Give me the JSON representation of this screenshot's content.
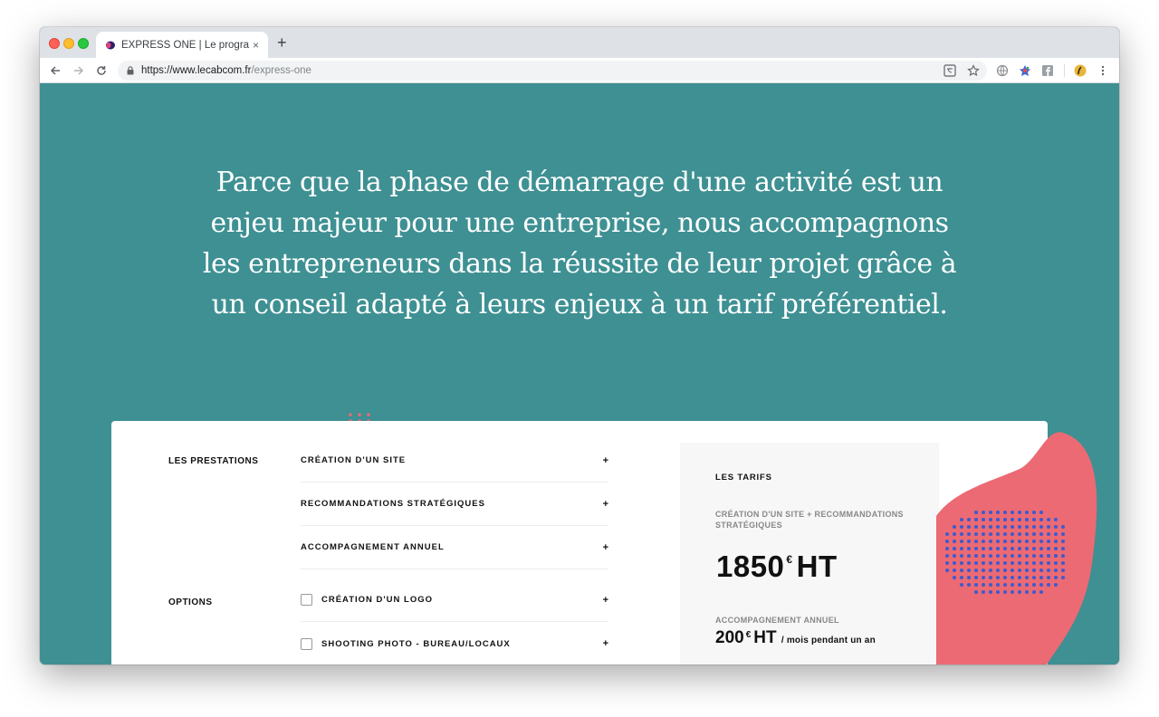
{
  "browser": {
    "tab_title": "EXPRESS ONE | Le programme",
    "tab_close": "×",
    "new_tab": "+",
    "url_host": "https://www.lecabcom.fr",
    "url_path": "/express-one"
  },
  "page": {
    "intro": "Parce que la phase de démarrage d'une activité est un enjeu majeur pour une entreprise, nous accompagnons les entrepreneurs dans la réussite de leur projet grâce à un conseil adapté à leurs enjeux à un tarif préférentiel."
  },
  "prestations": {
    "label": "LES PRESTATIONS",
    "items": [
      {
        "label": "CRÉATION D'UN SITE",
        "toggle": "+"
      },
      {
        "label": "RECOMMANDATIONS STRATÉGIQUES",
        "toggle": "+"
      },
      {
        "label": "ACCOMPAGNEMENT ANNUEL",
        "toggle": "+"
      }
    ]
  },
  "options": {
    "label": "OPTIONS",
    "items": [
      {
        "label": "CRÉATION D'UN LOGO",
        "toggle": "+",
        "checked": false
      },
      {
        "label": "SHOOTING PHOTO - BUREAU/LOCAUX",
        "toggle": "+",
        "checked": false
      }
    ]
  },
  "tarifs": {
    "title": "LES TARIFS",
    "subtitle": "CRÉATION D'UN SITE + RECOMMANDATIONS STRATÉGIQUES",
    "price_amount": "1850",
    "price_currency": "€",
    "price_suffix": "HT",
    "annual_label": "ACCOMPAGNEMENT ANNUEL",
    "annual_amount": "200",
    "annual_currency": "€",
    "annual_suffix": "HT",
    "annual_period": "/ mois pendant un an"
  },
  "colors": {
    "teal": "#3e9093",
    "coral": "#ec6a73",
    "dots_blue": "#3b5bd0"
  }
}
